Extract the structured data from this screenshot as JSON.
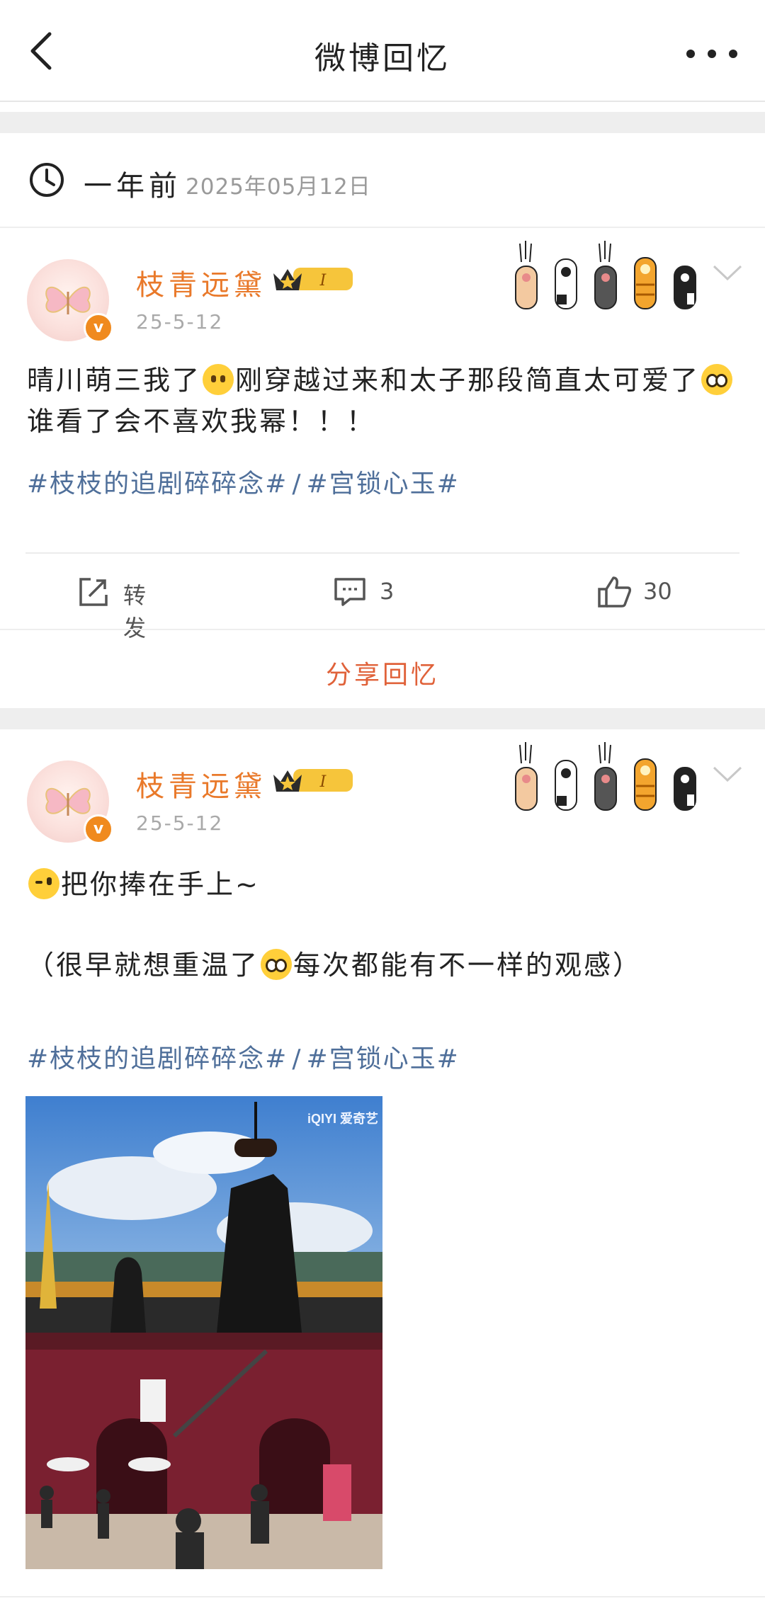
{
  "header": {
    "title": "微博回忆"
  },
  "memory": {
    "label": "一年前",
    "date": "2025年05月12日"
  },
  "posts": [
    {
      "username": "枝青远黛",
      "level": "I",
      "date": "25-5-12",
      "text_before": "晴川萌三我了",
      "text_mid": "刚穿越过来和太子那段简直太可爱了",
      "text_after": "谁看了会不喜欢我幂！！！",
      "tag1": "#枝枝的追剧碎碎念#",
      "tag_sep": "/",
      "tag2": "#宫锁心玉#",
      "actions": {
        "repost_label": "转发",
        "comment_count": "3",
        "like_count": "30"
      },
      "share_label": "分享回忆"
    },
    {
      "username": "枝青远黛",
      "level": "I",
      "date": "25-5-12",
      "line1": "把你捧在手上~",
      "line2_before": "（很早就想重温了",
      "line2_after": "每次都能有不一样的观感）",
      "tag1": "#枝枝的追剧碎碎念#",
      "tag_sep": "/",
      "tag2": "#宫锁心玉#",
      "image_watermark": "iQIYI 爱奇艺"
    }
  ],
  "icons": [
    "back-arrow-icon",
    "more-icon",
    "clock-icon",
    "verified-icon",
    "crown-icon",
    "paw-icon",
    "chevron-down-icon",
    "repost-icon",
    "comment-icon",
    "like-icon"
  ],
  "colors": {
    "username": "#e9792a",
    "tag": "#4f6f9a",
    "share": "#e0623a",
    "verified": "#f08a1e"
  }
}
